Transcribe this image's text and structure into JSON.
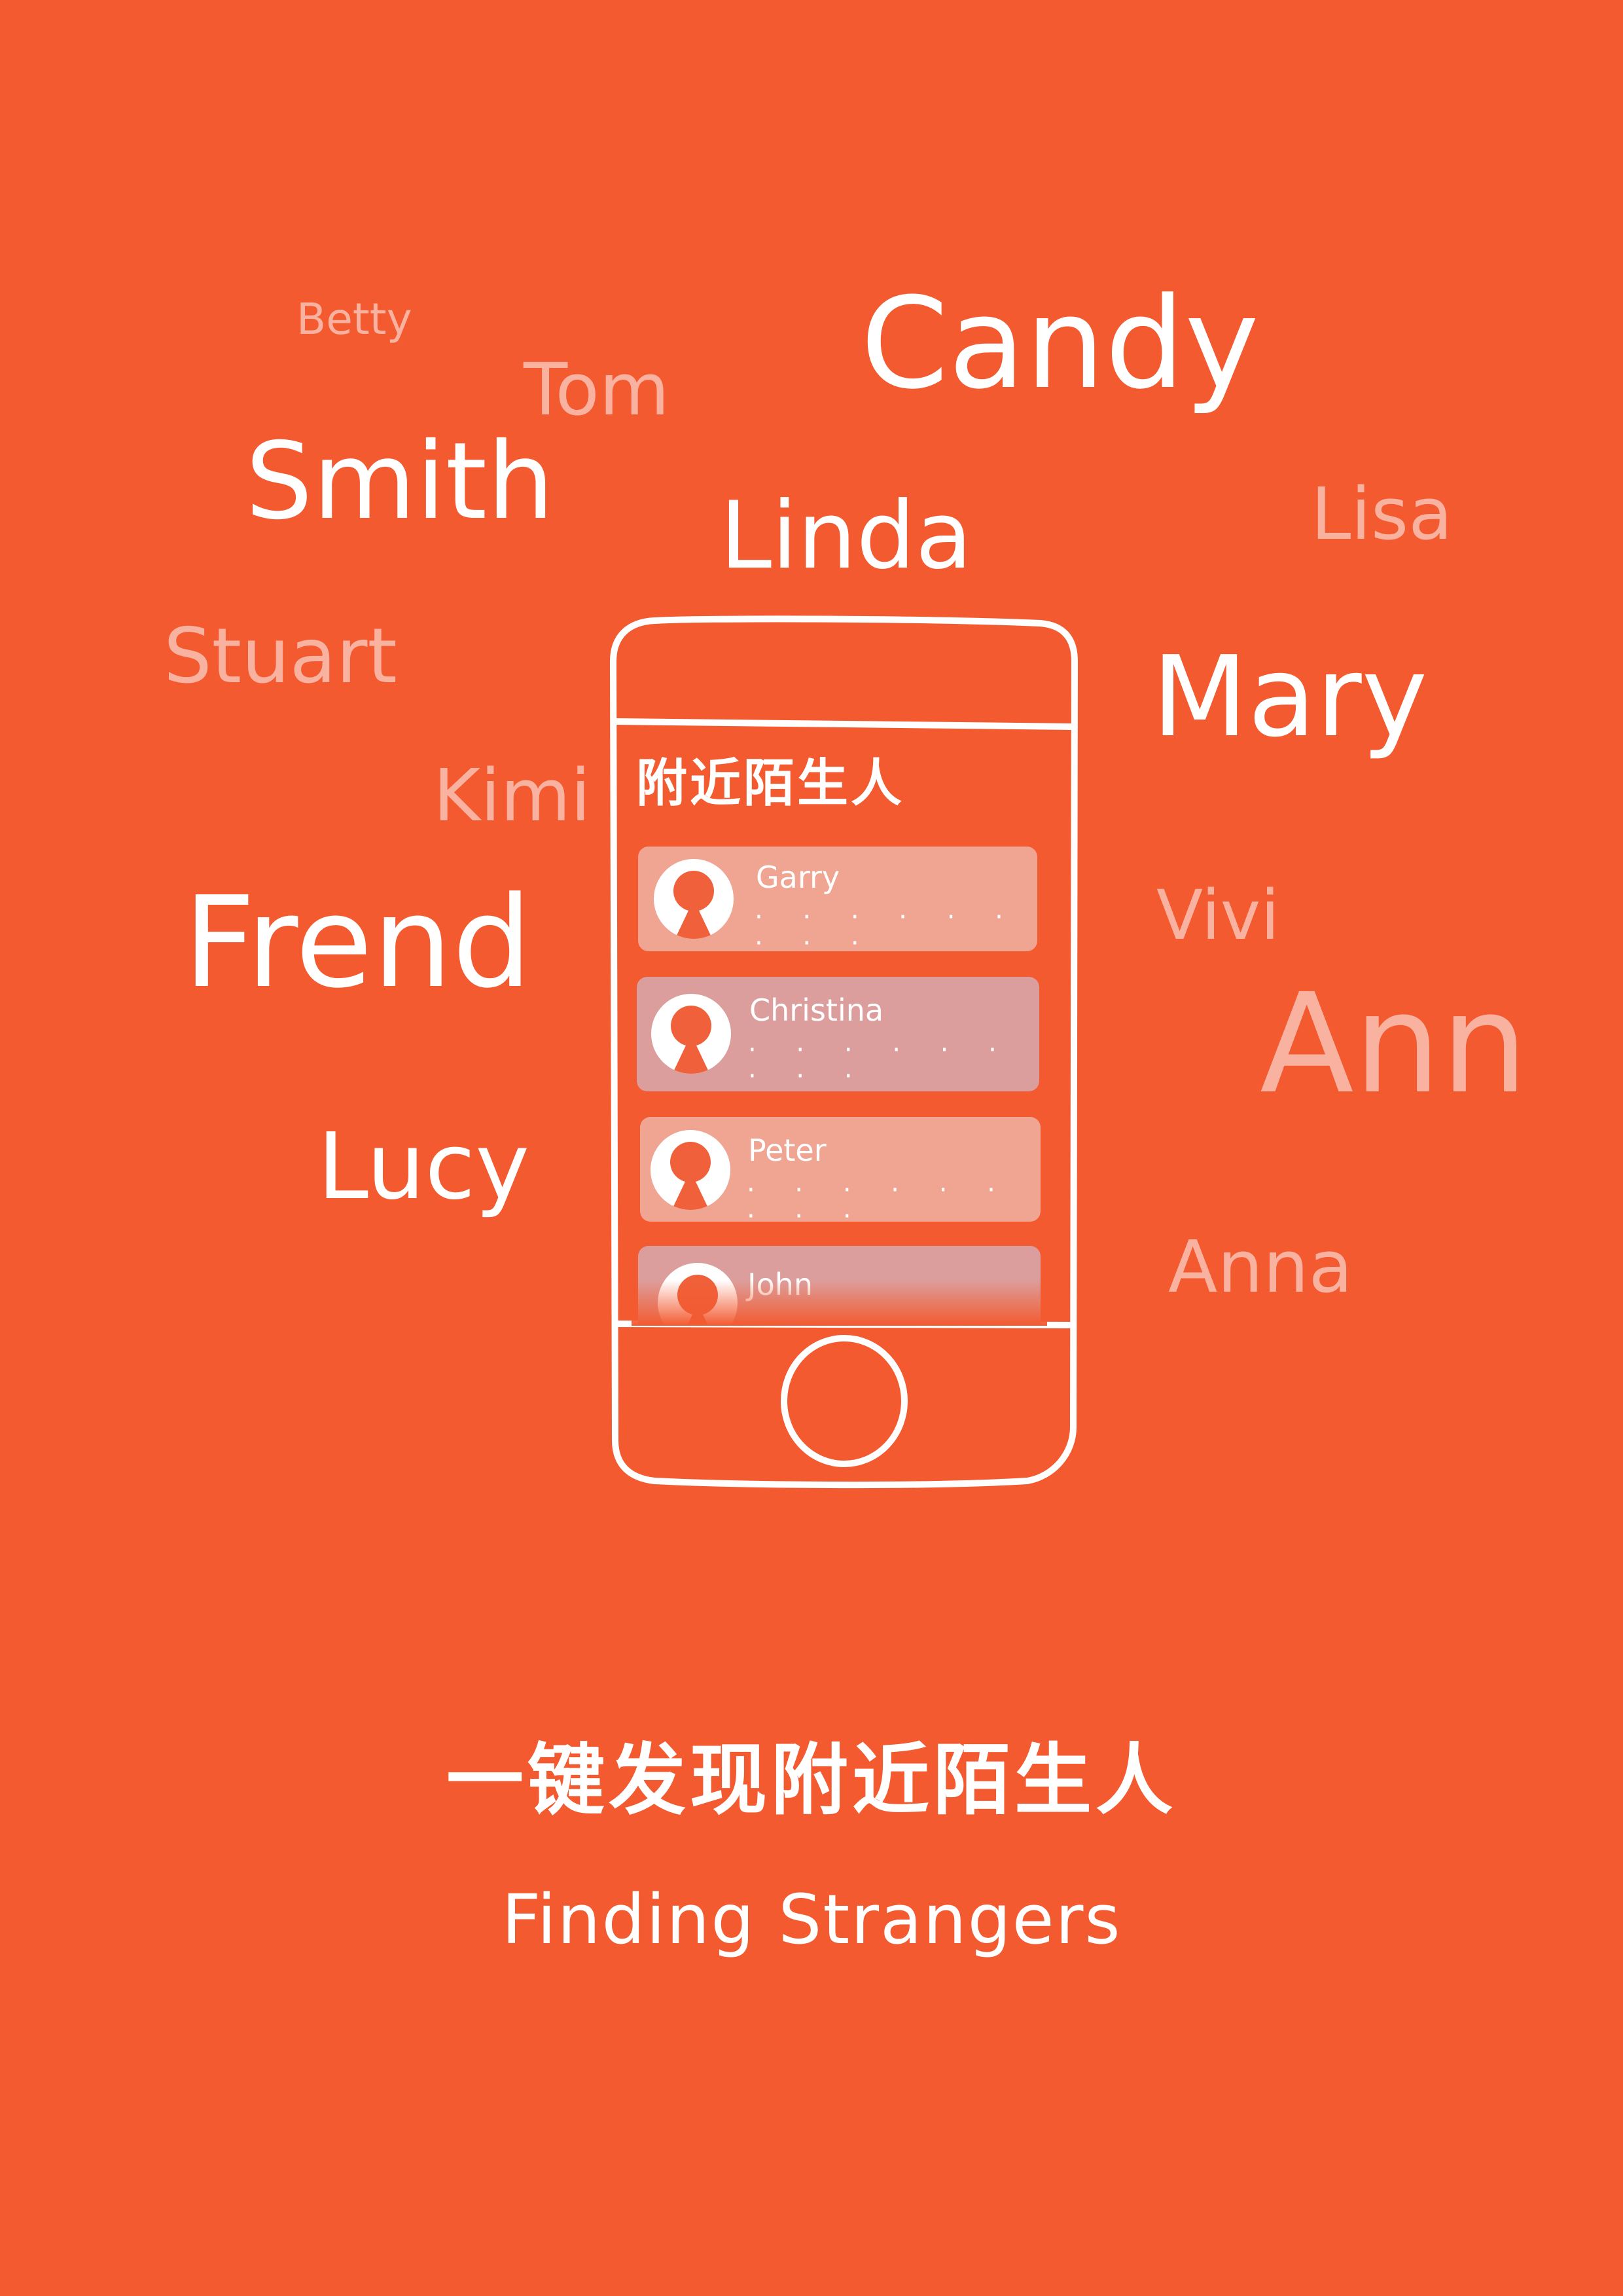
{
  "background_color": "#F35A30",
  "names": [
    {
      "id": "betty",
      "text": "Betty",
      "style": "faded"
    },
    {
      "id": "tom",
      "text": "Tom",
      "style": "faded"
    },
    {
      "id": "candy",
      "text": "Candy",
      "style": "white"
    },
    {
      "id": "smith",
      "text": "Smith",
      "style": "white"
    },
    {
      "id": "linda",
      "text": "Linda",
      "style": "white"
    },
    {
      "id": "lisa",
      "text": "Lisa",
      "style": "faded"
    },
    {
      "id": "stuart",
      "text": "Stuart",
      "style": "faded"
    },
    {
      "id": "mary",
      "text": "Mary",
      "style": "white"
    },
    {
      "id": "kimi",
      "text": "Kimi",
      "style": "faded"
    },
    {
      "id": "frend",
      "text": "Frend",
      "style": "white"
    },
    {
      "id": "vivi",
      "text": "Vivi",
      "style": "faded"
    },
    {
      "id": "ann",
      "text": "Ann",
      "style": "faded"
    },
    {
      "id": "lucy",
      "text": "Lucy",
      "style": "white"
    },
    {
      "id": "anna",
      "text": "Anna",
      "style": "faded"
    }
  ],
  "phone": {
    "screen_title": "附近陌生人",
    "items": [
      {
        "name": "Garry",
        "dots": "· · · · · · · · ·",
        "color": "#F0A592"
      },
      {
        "name": "Christina",
        "dots": "· · · · · · · · ·",
        "color": "#DC9E9C"
      },
      {
        "name": "Peter",
        "dots": "· · · · · · · · ·",
        "color": "#F0A592"
      },
      {
        "name": "John",
        "dots": "",
        "color": "#DC9E9C"
      }
    ]
  },
  "headline": "一键发现附近陌生人",
  "subtitle": "Finding Strangers"
}
